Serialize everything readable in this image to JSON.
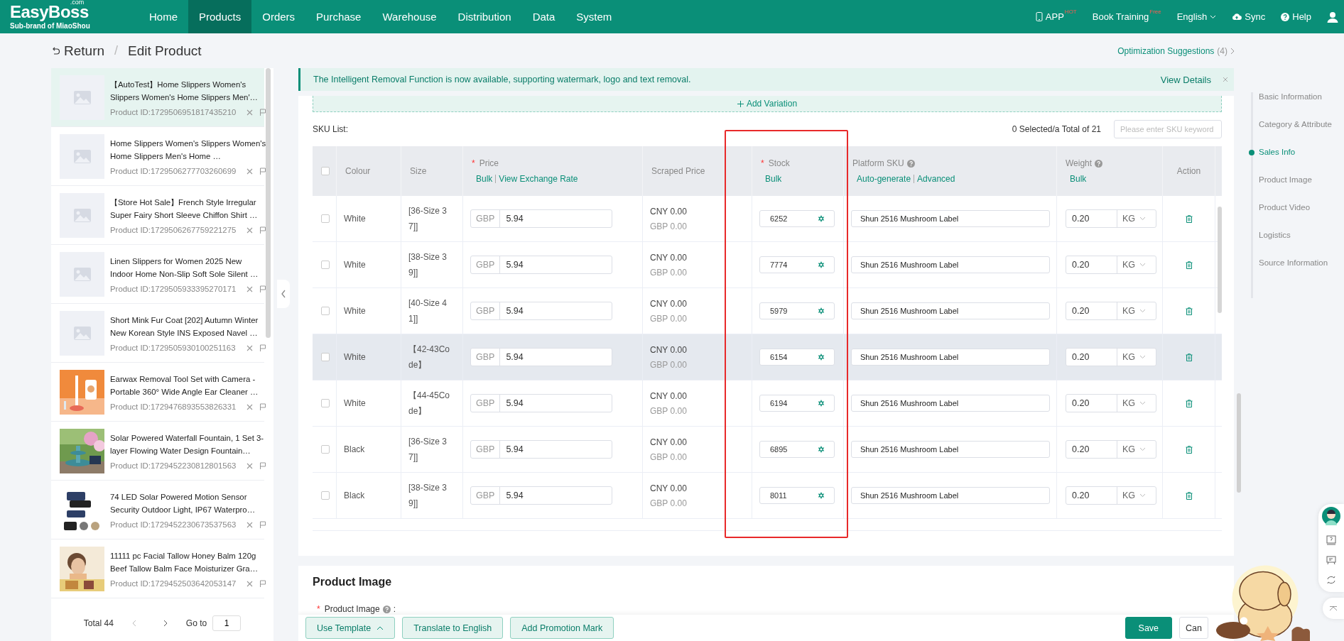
{
  "header": {
    "logo": "EasyBoss",
    "logo_suffix": ".com",
    "tagline": "Sub-brand of MiaoShou",
    "nav": [
      {
        "label": "Home",
        "selected": false
      },
      {
        "label": "Products",
        "selected": true
      },
      {
        "label": "Orders",
        "selected": false
      },
      {
        "label": "Purchase",
        "selected": false
      },
      {
        "label": "Warehouse",
        "selected": false
      },
      {
        "label": "Distribution",
        "selected": false
      },
      {
        "label": "Data",
        "selected": false
      },
      {
        "label": "System",
        "selected": false
      }
    ],
    "tools": [
      {
        "kind": "app",
        "label": "APP",
        "badge": "HOT"
      },
      {
        "kind": "training",
        "label": "Book Training",
        "badge": "Free"
      },
      {
        "kind": "language",
        "label": "English"
      },
      {
        "kind": "sync",
        "label": "Sync"
      },
      {
        "kind": "help",
        "label": "Help"
      },
      {
        "kind": "user"
      }
    ]
  },
  "page": {
    "back": "Return",
    "separator": "/",
    "title": "Edit Product",
    "suggestions": "Optimization Suggestions",
    "suggestions_count": "(4)"
  },
  "products": {
    "items": [
      {
        "title": "【AutoTest】Home Slippers Women's Slippers Women's Home Slippers Men'…",
        "id": "Product ID:1729506951817435210",
        "selected": true,
        "kind": "placeholder"
      },
      {
        "title": "Home Slippers Women's Slippers Women's Home Slippers Men's Home …",
        "id": "Product ID:1729506277703260699",
        "selected": false,
        "kind": "placeholder"
      },
      {
        "title": "【Store Hot Sale】French Style Irregular Super Fairy Short Sleeve Chiffon Shirt …",
        "id": "Product ID:1729506267759221275",
        "selected": false,
        "kind": "placeholder"
      },
      {
        "title": "Linen Slippers for Women 2025 New Indoor Home Non-Slip Soft Sole Silent …",
        "id": "Product ID:1729505933395270171",
        "selected": false,
        "kind": "placeholder"
      },
      {
        "title": "Short Mink Fur Coat [202] Autumn Winter New Korean Style INS Exposed Navel …",
        "id": "Product ID:1729505930100251163",
        "selected": false,
        "kind": "placeholder"
      },
      {
        "title": "Earwax Removal Tool Set with Camera - Portable 360° Wide Angle Ear Cleaner …",
        "id": "Product ID:1729476893553826331",
        "selected": false,
        "kind": "picture"
      },
      {
        "title": "Solar Powered Waterfall Fountain, 1 Set 3-layer Flowing Water Design Fountain…",
        "id": "Product ID:1729452230812801563",
        "selected": false,
        "kind": "picture"
      },
      {
        "title": "74 LED Solar Powered Motion Sensor Security Outdoor Light, IP67 Waterpro…",
        "id": "Product ID:1729452230673537563",
        "selected": false,
        "kind": "picture"
      },
      {
        "title": "11111 pc Facial Tallow Honey Balm 120g Beef Tallow Balm Face Moisturizer Gra…",
        "id": "Product ID:1729452503642053147",
        "selected": false,
        "kind": "picture"
      }
    ],
    "pagination": {
      "total": "Total 44",
      "goto": "Go to",
      "page": "1"
    }
  },
  "notice": {
    "text": "The Intelligent Removal Function is now available, supporting watermark, logo and text removal.",
    "link": "View Details"
  },
  "sku": {
    "add_variation": "Add Variation",
    "required_symbol": "*",
    "label": "SKU List:",
    "summary": "0 Selected/a Total of 21",
    "search_placeholder": "Please enter SKU keyword",
    "all_checked": false,
    "columns": [
      {
        "kind": "check"
      },
      {
        "kind": "text",
        "label": "Colour",
        "required": false,
        "help": false
      },
      {
        "kind": "text",
        "label": "Size",
        "required": false,
        "help": false
      },
      {
        "kind": "text",
        "label": "Price",
        "required": true,
        "help": false,
        "links": [
          "Bulk",
          "View Exchange Rate"
        ]
      },
      {
        "kind": "text",
        "label": "Scraped Price",
        "required": false,
        "help": false
      },
      {
        "kind": "text",
        "label": "Stock",
        "required": true,
        "help": false,
        "links": [
          "Bulk"
        ]
      },
      {
        "kind": "text",
        "label": "Platform SKU",
        "required": false,
        "help": true,
        "links": [
          "Auto-generate",
          "Advanced"
        ]
      },
      {
        "kind": "text",
        "label": "Weight",
        "required": false,
        "help": true,
        "links": [
          "Bulk"
        ]
      },
      {
        "kind": "text",
        "label": "Action",
        "required": false,
        "help": false
      }
    ],
    "rows": [
      {
        "checked": false,
        "highlighted": false,
        "colour": "White",
        "size": "[36-Size 37]]",
        "currency": "GBP",
        "price": "5.94",
        "scraped_cny": "CNY 0.00",
        "scraped_gbp": "GBP 0.00",
        "stock": "6252",
        "platform_sku": "Shun 2516 Mushroom Label",
        "weight": "0.20",
        "unit": "KG"
      },
      {
        "checked": false,
        "highlighted": false,
        "colour": "White",
        "size": "[38-Size 39]]",
        "currency": "GBP",
        "price": "5.94",
        "scraped_cny": "CNY 0.00",
        "scraped_gbp": "GBP 0.00",
        "stock": "7774",
        "platform_sku": "Shun 2516 Mushroom Label",
        "weight": "0.20",
        "unit": "KG"
      },
      {
        "checked": false,
        "highlighted": false,
        "colour": "White",
        "size": "[40-Size 41]]",
        "currency": "GBP",
        "price": "5.94",
        "scraped_cny": "CNY 0.00",
        "scraped_gbp": "GBP 0.00",
        "stock": "5979",
        "platform_sku": "Shun 2516 Mushroom Label",
        "weight": "0.20",
        "unit": "KG"
      },
      {
        "checked": false,
        "highlighted": true,
        "colour": "White",
        "size": "【42-43Code】",
        "currency": "GBP",
        "price": "5.94",
        "scraped_cny": "CNY 0.00",
        "scraped_gbp": "GBP 0.00",
        "stock": "6154",
        "platform_sku": "Shun 2516 Mushroom Label",
        "weight": "0.20",
        "unit": "KG"
      },
      {
        "checked": false,
        "highlighted": false,
        "colour": "White",
        "size": "【44-45Code】",
        "currency": "GBP",
        "price": "5.94",
        "scraped_cny": "CNY 0.00",
        "scraped_gbp": "GBP 0.00",
        "stock": "6194",
        "platform_sku": "Shun 2516 Mushroom Label",
        "weight": "0.20",
        "unit": "KG"
      },
      {
        "checked": false,
        "highlighted": false,
        "colour": "Black",
        "size": "[36-Size 37]]",
        "currency": "GBP",
        "price": "5.94",
        "scraped_cny": "CNY 0.00",
        "scraped_gbp": "GBP 0.00",
        "stock": "6895",
        "platform_sku": "Shun 2516 Mushroom Label",
        "weight": "0.20",
        "unit": "KG"
      },
      {
        "checked": false,
        "highlighted": false,
        "colour": "Black",
        "size": "[38-Size 39]]",
        "currency": "GBP",
        "price": "5.94",
        "scraped_cny": "CNY 0.00",
        "scraped_gbp": "GBP 0.00",
        "stock": "8011",
        "platform_sku": "Shun 2516 Mushroom Label",
        "weight": "0.20",
        "unit": "KG"
      }
    ]
  },
  "annotations": [
    {
      "kind": "box"
    }
  ],
  "image_section": {
    "title": "Product Image",
    "field_label": "Product Image",
    "required": true,
    "required_symbol": "*",
    "label_suffix": ":"
  },
  "section_nav": [
    {
      "label": "Basic Information",
      "selected": false
    },
    {
      "label": "Category & Attribute",
      "selected": false
    },
    {
      "label": "Sales Info",
      "selected": true
    },
    {
      "label": "Product Image",
      "selected": false
    },
    {
      "label": "Product Video",
      "selected": false
    },
    {
      "label": "Logistics",
      "selected": false
    },
    {
      "label": "Source Information",
      "selected": false
    }
  ],
  "footer": {
    "buttons": [
      {
        "label": "Use Template",
        "kind": "dropdown"
      },
      {
        "label": "Translate to English",
        "kind": "secondary"
      },
      {
        "label": "Add Promotion Mark",
        "kind": "secondary"
      },
      {
        "label": "Save",
        "kind": "primary"
      },
      {
        "label": "Can",
        "kind": "default"
      }
    ]
  }
}
